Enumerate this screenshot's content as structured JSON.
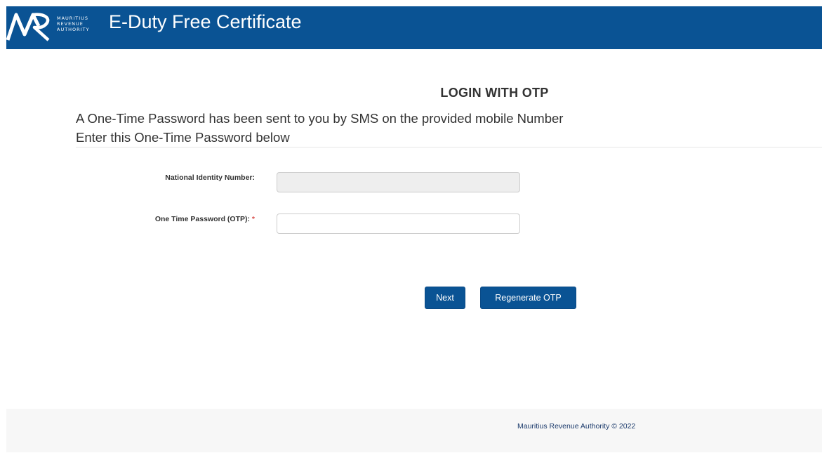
{
  "header": {
    "logo_lines": [
      "MAURITIUS",
      "REVENUE",
      "AUTHORITY"
    ],
    "app_title": "E-Duty Free Certificate"
  },
  "main": {
    "heading": "LOGIN WITH OTP",
    "message_line1": "A One-Time Password has been sent to you by SMS on the provided mobile Number",
    "message_line2": "Enter this One-Time Password below",
    "fields": {
      "nin": {
        "label": "National Identity Number:",
        "value": "",
        "disabled": true
      },
      "otp": {
        "label": "One Time Password (OTP):",
        "required_marker": "*",
        "value": ""
      }
    },
    "buttons": {
      "next": "Next",
      "regenerate": "Regenerate OTP"
    }
  },
  "footer": {
    "text": "Mauritius Revenue Authority © 2022"
  },
  "colors": {
    "brand": "#0a5394",
    "required": "#d9534f"
  }
}
